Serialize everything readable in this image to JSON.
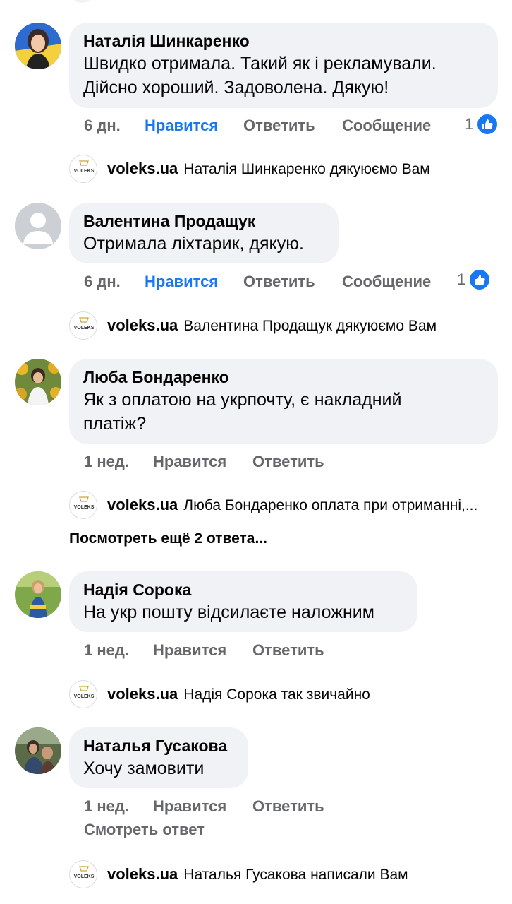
{
  "comments": [
    {
      "author": "Наталія Шинкаренко",
      "text_lines": [
        "Швидко отримала. Такий як і рекламували.",
        "Дійсно хороший. Задоволена. Дякую!"
      ],
      "time": "6 дн.",
      "like_label": "Нравится",
      "reply_label": "Ответить",
      "message_label": "Сообщение",
      "reaction_count": "1",
      "reply": {
        "author": "voleks.ua",
        "text": "Наталія Шинкаренко дякуюємо Вам"
      }
    },
    {
      "author": "Валентина Продащук",
      "text_lines": [
        "Отримала ліхтарик, дякую."
      ],
      "time": "6 дн.",
      "like_label": "Нравится",
      "reply_label": "Ответить",
      "message_label": "Сообщение",
      "reaction_count": "1",
      "reply": {
        "author": "voleks.ua",
        "text": "Валентина Продащук дякуюємо Вам"
      }
    },
    {
      "author": "Люба Бондаренко",
      "text_lines": [
        "Як з оплатою на укрпочту, є накладний",
        "платіж?"
      ],
      "time": "1 нед.",
      "like_label": "Нравится",
      "reply_label": "Ответить",
      "reply": {
        "author": "voleks.ua",
        "text": "Люба Бондаренко оплата при отриманні,..."
      },
      "more_replies": "Посмотреть ещё 2 ответа..."
    },
    {
      "author": "Надія Сорока",
      "text_lines": [
        "На укр пошту відсилаєте наложним"
      ],
      "time": "1 нед.",
      "like_label": "Нравится",
      "reply_label": "Ответить",
      "reply": {
        "author": "voleks.ua",
        "text": "Надія Сорока так звичайно"
      }
    },
    {
      "author": "Наталья Гусакова",
      "text_lines": [
        "Хочу замовити"
      ],
      "time": "1 нед.",
      "like_label": "Нравится",
      "reply_label": "Ответить",
      "see_reply": "Смотреть ответ",
      "reply": {
        "author": "voleks.ua",
        "text": "Наталья Гусакова написали Вам"
      }
    }
  ],
  "page_logo_text": "VOLEKS",
  "colors": {
    "accent": "#1877f2",
    "bubble": "#f0f2f5",
    "muted": "#65676b",
    "text": "#050505"
  }
}
